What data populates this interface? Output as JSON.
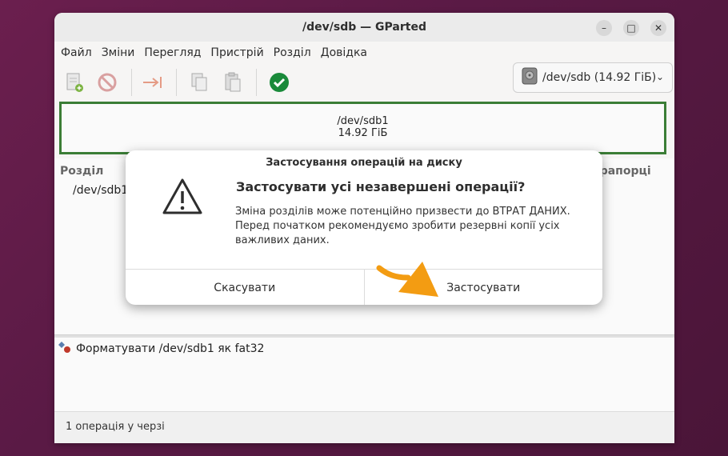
{
  "window": {
    "title": "/dev/sdb — GParted"
  },
  "menu": [
    "Файл",
    "Зміни",
    "Перегляд",
    "Пристрій",
    "Розділ",
    "Довідка"
  ],
  "toolbar": {
    "icons": [
      "new-partition-icon",
      "delete-icon",
      "resize-move-icon",
      "copy-icon",
      "paste-icon",
      "apply-icon"
    ],
    "device_selector": "/dev/sdb (14.92 ГіБ)"
  },
  "disk_map": {
    "partition": "/dev/sdb1",
    "size": "14.92 ГіБ"
  },
  "partition_list": {
    "headers": {
      "partition": "Розділ",
      "flags": "Прапорці"
    },
    "rows": [
      {
        "partition": "/dev/sdb1"
      }
    ]
  },
  "operations": [
    {
      "text": "Форматувати /dev/sdb1 як fat32"
    }
  ],
  "status": "1 операція у черзі",
  "dialog": {
    "title": "Застосування операцій на диску",
    "heading": "Застосувати усі незавершені операції?",
    "body": "Зміна розділів може потенційно призвести до ВТРАТ ДАНИХ. Перед початком рекомендуємо зробити резервні копії усіх важливих даних.",
    "cancel_label": "Скасувати",
    "apply_label": "Застосувати"
  },
  "colors": {
    "accent_border": "#3b7d36",
    "apply_icon": "#1a8a3a",
    "arrow": "#f39c12"
  }
}
